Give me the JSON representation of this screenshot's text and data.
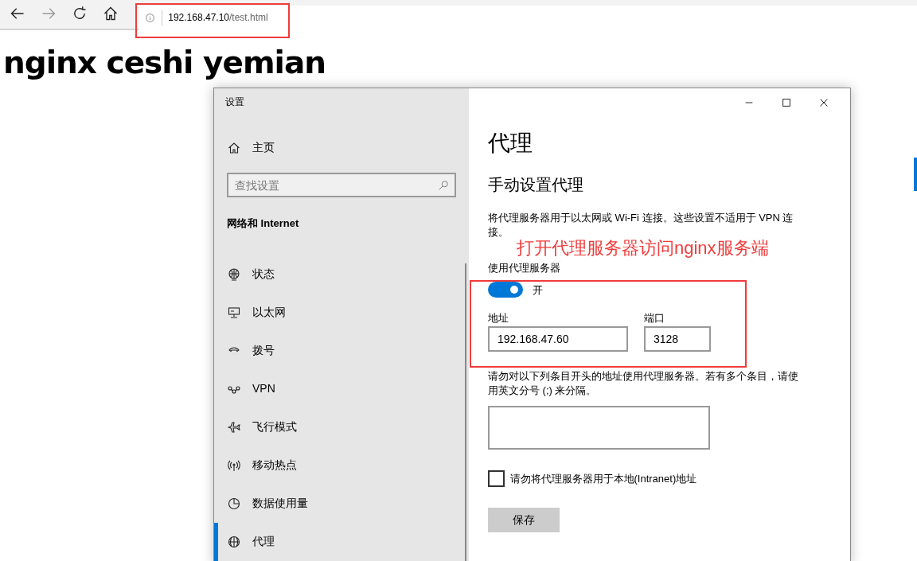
{
  "browser": {
    "url_host": "192.168.47.10",
    "url_path": "/test.html"
  },
  "page": {
    "heading": "nginx ceshi yemian"
  },
  "settings_window": {
    "title": "设置",
    "home": "主页",
    "search_placeholder": "查找设置",
    "section": "网络和 Internet",
    "nav_items": [
      {
        "kind": "status",
        "label": "状态",
        "selected": false
      },
      {
        "kind": "ethernet",
        "label": "以太网",
        "selected": false
      },
      {
        "kind": "dialup",
        "label": "拨号",
        "selected": false
      },
      {
        "kind": "vpn",
        "label": "VPN",
        "selected": false
      },
      {
        "kind": "airplane",
        "label": "飞行模式",
        "selected": false
      },
      {
        "kind": "hotspot",
        "label": "移动热点",
        "selected": false
      },
      {
        "kind": "datausage",
        "label": "数据使用量",
        "selected": false
      },
      {
        "kind": "proxy",
        "label": "代理",
        "selected": true
      }
    ],
    "content": {
      "title": "代理",
      "subtitle": "手动设置代理",
      "description": "将代理服务器用于以太网或 Wi-Fi 连接。这些设置不适用于 VPN 连接。",
      "toggle": {
        "label": "使用代理服务器",
        "on": true,
        "state_text": "开"
      },
      "address": {
        "label": "地址",
        "value": "192.168.47.60"
      },
      "port": {
        "label": "端口",
        "value": "3128"
      },
      "exceptions_text": "请勿对以下列条目开头的地址使用代理服务器。若有多个条目，请使用英文分号 (;) 来分隔。",
      "local_checkbox": {
        "label": "请勿将代理服务器用于本地(Intranet)地址",
        "checked": false
      },
      "save_button": "保存"
    }
  },
  "annotation": {
    "text": "打开代理服务器访问nginx服务端"
  }
}
